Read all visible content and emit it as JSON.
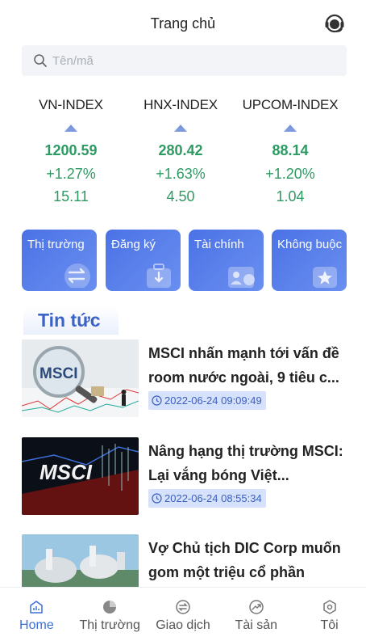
{
  "header": {
    "title": "Trang chủ",
    "support_icon": "headset-icon"
  },
  "search": {
    "placeholder": "Tên/mã"
  },
  "indices": [
    {
      "name": "VN-INDEX",
      "value": "1200.59",
      "percent": "+1.27%",
      "change": "15.11",
      "direction": "up"
    },
    {
      "name": "HNX-INDEX",
      "value": "280.42",
      "percent": "+1.63%",
      "change": "4.50",
      "direction": "up"
    },
    {
      "name": "UPCOM-INDEX",
      "value": "88.14",
      "percent": "+1.20%",
      "change": "1.04",
      "direction": "up"
    }
  ],
  "tiles": [
    {
      "label": "Thị trường",
      "icon": "transfer-arrows-icon"
    },
    {
      "label": "Đăng ký",
      "icon": "briefcase-icon"
    },
    {
      "label": "Tài chính",
      "icon": "id-card-icon"
    },
    {
      "label": "Không buộc",
      "icon": "star-icon"
    }
  ],
  "news": {
    "section_title": "Tin tức",
    "items": [
      {
        "headline": "MSCI nhấn mạnh tới vấn đề room nước ngoài, 9 tiêu c...",
        "date": "2022-06-24 09:09:49",
        "thumb_text": "MSCI"
      },
      {
        "headline": "Nâng hạng thị trường MSCI: Lại vắng bóng Việt...",
        "date": "2022-06-24 08:55:34",
        "thumb_text": "MSCI"
      },
      {
        "headline": "Vợ Chủ tịch DIC Corp muốn gom một triệu cổ phần",
        "date": "",
        "thumb_text": ""
      }
    ]
  },
  "tabbar": [
    {
      "label": "Home",
      "icon": "home-chart-icon",
      "active": true
    },
    {
      "label": "Thị trường",
      "icon": "pie-chart-icon",
      "active": false
    },
    {
      "label": "Giao dịch",
      "icon": "exchange-icon",
      "active": false
    },
    {
      "label": "Tài sản",
      "icon": "trend-icon",
      "active": false
    },
    {
      "label": "Tôi",
      "icon": "hexagon-icon",
      "active": false
    }
  ],
  "colors": {
    "accent": "#3b6fd8",
    "up": "#2e9a63",
    "tile": "#4b72e6"
  }
}
